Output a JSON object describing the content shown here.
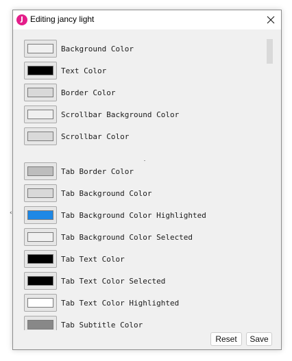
{
  "background": {
    "caret_glyph": "‹"
  },
  "dialog": {
    "title": "Editing jancy light",
    "app_icon_letter": "J",
    "app_icon_color": "#e41e8a"
  },
  "settings": [
    {
      "label": "Background Color",
      "color": "#f0f0f0"
    },
    {
      "label": "Text Color",
      "color": "#000000"
    },
    {
      "label": "Border Color",
      "color": "#d9d9d9"
    },
    {
      "label": "Scrollbar Background Color",
      "color": "#f0f0f0"
    },
    {
      "label": "Scrollbar Color",
      "color": "#d9d9d9"
    },
    {
      "label": "Tab Border Color",
      "color": "#bdbdbd"
    },
    {
      "label": "Tab Background Color",
      "color": "#d9d9d9"
    },
    {
      "label": "Tab Background Color Highlighted",
      "color": "#1e88e5"
    },
    {
      "label": "Tab Background Color Selected",
      "color": "#f0f0f0"
    },
    {
      "label": "Tab Text Color",
      "color": "#000000"
    },
    {
      "label": "Tab Text Color Selected",
      "color": "#000000"
    },
    {
      "label": "Tab Text Color Highlighted",
      "color": "#ffffff"
    },
    {
      "label": "Tab Subtitle Color",
      "color": "#888888"
    }
  ],
  "footer": {
    "reset_label": "Reset",
    "save_label": "Save"
  }
}
